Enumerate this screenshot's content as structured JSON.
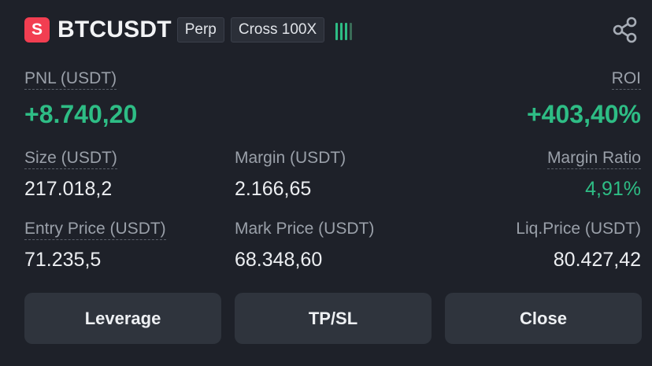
{
  "header": {
    "side_badge": "S",
    "symbol": "BTCUSDT",
    "contract_type": "Perp",
    "margin_mode": "Cross 100X",
    "signal_bars_icon": "signal-strength-bars",
    "share_icon": "share-icon"
  },
  "pnl": {
    "label": "PNL (USDT)",
    "value": "+8.740,20"
  },
  "roi": {
    "label": "ROI",
    "value": "+403,40%"
  },
  "stats": {
    "size": {
      "label": "Size (USDT)",
      "value": "217.018,2"
    },
    "margin": {
      "label": "Margin (USDT)",
      "value": "2.166,65"
    },
    "margin_ratio": {
      "label": "Margin Ratio",
      "value": "4,91%"
    },
    "entry_price": {
      "label": "Entry Price (USDT)",
      "value": "71.235,5"
    },
    "mark_price": {
      "label": "Mark Price (USDT)",
      "value": "68.348,60"
    },
    "liq_price": {
      "label": "Liq.Price (USDT)",
      "value": "80.427,42"
    }
  },
  "actions": {
    "leverage": "Leverage",
    "tpsl": "TP/SL",
    "close": "Close"
  },
  "colors": {
    "background": "#1e2129",
    "profit_green": "#2ebd85",
    "short_red": "#f23e51",
    "button_bg": "#2f343d",
    "label_gray": "#9aa0a9"
  }
}
